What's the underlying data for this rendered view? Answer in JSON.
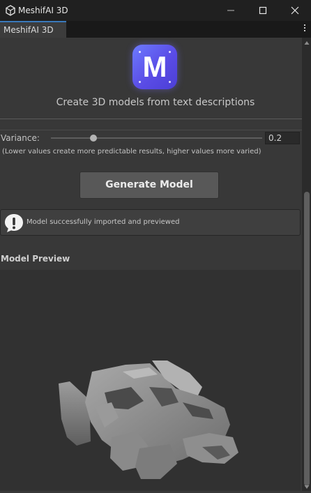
{
  "window": {
    "title": "MeshifAI 3D"
  },
  "tab": {
    "label": "MeshifAI 3D"
  },
  "header": {
    "logo_letter": "M",
    "subtitle": "Create 3D models from text descriptions"
  },
  "variance": {
    "label": "Variance:",
    "value": "0.2",
    "slider_fraction": 0.2,
    "hint": "(Lower values create more predictable results, higher values more varied)"
  },
  "generate_button": {
    "label": "Generate Model"
  },
  "notice": {
    "icon": "exclamation-bubble-icon",
    "text": "Model successfully imported and previewed"
  },
  "preview": {
    "heading": "Model Preview"
  },
  "colors": {
    "background": "#383838",
    "logo_gradient_start": "#6d7bff",
    "logo_gradient_end": "#4c3fd6",
    "tab_accent": "#3a79bb"
  }
}
